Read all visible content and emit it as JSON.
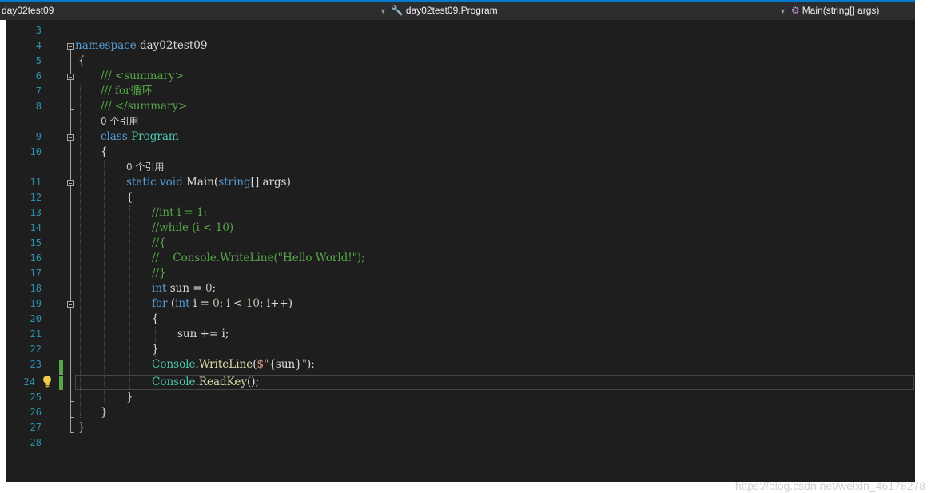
{
  "navigation": {
    "project": "day02test09",
    "type": "day02test09.Program",
    "member": "Main(string[] args)",
    "dropdown_glyph": "▼",
    "type_icon": "class-icon",
    "member_icon": "method-icon"
  },
  "line_numbers": [
    "3",
    "4",
    "5",
    "6",
    "7",
    "8",
    "9",
    "10",
    "11",
    "12",
    "13",
    "14",
    "15",
    "16",
    "17",
    "18",
    "19",
    "20",
    "21",
    "22",
    "23",
    "24",
    "25",
    "26",
    "27",
    "28"
  ],
  "code": {
    "namespace_keyword": "namespace",
    "namespace_name": " day02test09",
    "open_brace": "{",
    "close_brace": "}",
    "summary_open": "/// <summary>",
    "summary_body": "/// for循环",
    "summary_close": "/// </summary>",
    "references": "0 个引用",
    "class_keyword": "class",
    "class_name": "Program",
    "static_kw": "static",
    "void_kw": "void",
    "main_name": "Main",
    "string_kw": "string",
    "main_params": "[] args)",
    "comment_13": "//int i = 1;",
    "comment_14": "//while (i < 10)",
    "comment_15": "//{",
    "comment_16": "//    Console.WriteLine(\"Hello World!\");",
    "comment_17": "//}",
    "int_kw": "int",
    "sun_decl": " sun = ",
    "zero": "0",
    "for_kw": "for",
    "for_mid_a": " i = ",
    "for_mid_b": "; i < ",
    "ten": "10",
    "for_tail": "; i++)",
    "sum_line": "sun += i;",
    "console": "Console",
    "writeline": "WriteLine",
    "interp_open": "$\"",
    "interp_expr": "{sun}",
    "interp_close": "\"",
    "readkey": "ReadKey",
    "call_close": ");",
    "call_empty": "();"
  },
  "watermark": "https://blog.csdn.net/weixin_46178278",
  "colors": {
    "keyword": "#569cd6",
    "comment": "#57a64a",
    "type": "#4ec9b0",
    "string": "#d69d85",
    "number": "#b5cea8",
    "method": "#dcdcaa",
    "line_number": "#2b91af",
    "editor_bg": "#1e1e1e"
  }
}
